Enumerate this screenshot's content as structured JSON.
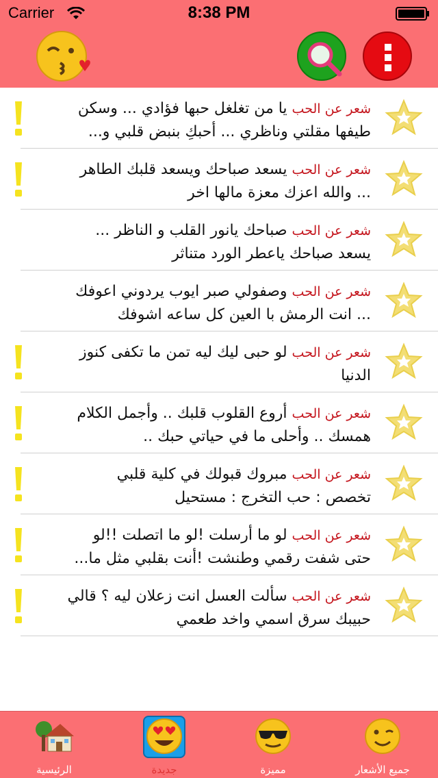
{
  "status_bar": {
    "carrier": "Carrier",
    "time": "8:38 PM"
  },
  "nav": {
    "left_icon": "kiss-emoji-icon",
    "search_icon": "search-icon",
    "menu_icon": "more-vertical-icon",
    "accent_color": "#fb6f73"
  },
  "list": {
    "items": [
      {
        "tag": "شعر عن الحب",
        "line1": "يا من تغلغل حبها فؤادي ... وسكن",
        "line2": "طيفها مقلتي وناظري ... أحبكِ بنبض قلبي و...",
        "alert": true
      },
      {
        "tag": "شعر عن الحب",
        "line1": "يسعد صباحك ويسعد قلبك الطاهر",
        "line2": "... والله اعزك معزة مالها اخر",
        "alert": true
      },
      {
        "tag": "شعر عن الحب",
        "line1": "صباحك يانور القلب و الناظر ...",
        "line2": "يسعد صباحك ياعطر الورد متناثر",
        "alert": false
      },
      {
        "tag": "شعر عن الحب",
        "line1": "وصفولي صبر ايوب يردوني اعوفك",
        "line2": "... انت الرمش با العين كل ساعه اشوفك",
        "alert": false
      },
      {
        "tag": "شعر عن الحب",
        "line1": "لو حبى ليك ليه تمن ما تكفى كنوز",
        "line2": "الدنيا",
        "alert": true
      },
      {
        "tag": "شعر عن الحب",
        "line1": "أروع القلوب قلبك .. وأجمل الكلام",
        "line2": "همسك .. وأحلى ما في حياتي حبك ..",
        "alert": true
      },
      {
        "tag": "شعر عن الحب",
        "line1": "مبروك قبولك في كلية قلبي",
        "line2": "تخصص : حب التخرج : مستحيل",
        "alert": true
      },
      {
        "tag": "شعر عن الحب",
        "line1": "لو ما أرسلت !لو ما اتصلت !!لو",
        "line2": "حتى شفت رقمي وطنشت !أنت بقلبي مثل ما...",
        "alert": true
      },
      {
        "tag": "شعر عن الحب",
        "line1": "سألت العسل انت زعلان ليه ؟ قالي",
        "line2": "حبيبك سرق اسمي واخد طعمي",
        "alert": true
      }
    ]
  },
  "tabbar": {
    "tabs": [
      {
        "label": "الرئيسية",
        "icon": "house-icon"
      },
      {
        "label": "جديدة",
        "icon": "heart-eyes-emoji-icon",
        "active": true
      },
      {
        "label": "مميزة",
        "icon": "sunglasses-emoji-icon"
      },
      {
        "label": "جميع الأشعار",
        "icon": "wink-emoji-icon"
      }
    ]
  }
}
